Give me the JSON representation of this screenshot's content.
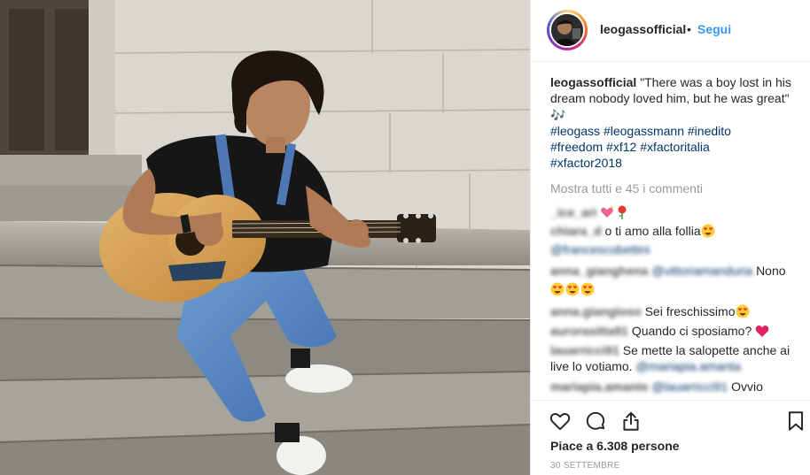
{
  "post": {
    "username": "leogassofficial",
    "dot": "•",
    "follow_label": "Segui",
    "caption_text": "\"There was a boy lost in his dream nobody loved him, but he was great\" 🎶",
    "hashtags": [
      "#leogass",
      "#leogassmann",
      "#inedito",
      "#freedom",
      "#xf12",
      "#xfactoritalia",
      "#xfactor2018"
    ],
    "show_all_comments": "Mostra tutti e 45 i commenti",
    "likes": "Piace a 6.308 persone",
    "date": "30 SETTEMBRE"
  },
  "comments": [
    {
      "user": "_ice_ari",
      "mention": "",
      "text": ""
    },
    {
      "user": "chiara_d",
      "mention": "",
      "text": "o ti amo alla follia"
    },
    {
      "user": "anna_gianghena",
      "mention": "@vittoriamanduria",
      "text": "Nono"
    },
    {
      "user": "anna.giangioso",
      "mention": "",
      "text": "Sei freschissimo"
    },
    {
      "user": "aurorasitta91",
      "mention": "",
      "text": "Quando ci sposiamo?"
    },
    {
      "user": "lauarricci91",
      "mention": "@mariapia.amanta",
      "text": "Se mette la salopette anche ai live lo votiamo."
    },
    {
      "user": "mariapia.amante",
      "mention": "@lauarricci91",
      "text": "Ovvio"
    }
  ],
  "icons": {
    "like": "heart-icon",
    "comment": "comment-icon",
    "share": "share-icon",
    "save": "bookmark-icon",
    "music": "music-notes-icon",
    "heart_emoji": "sparkle-heart-icon",
    "rose": "rose-icon",
    "heart_eyes": "heart-eyes-icon",
    "red_heart": "red-heart-icon"
  },
  "colors": {
    "link": "#3897f0",
    "hashtag": "#003569",
    "muted": "#999999",
    "text": "#262626",
    "border": "#efefef"
  }
}
